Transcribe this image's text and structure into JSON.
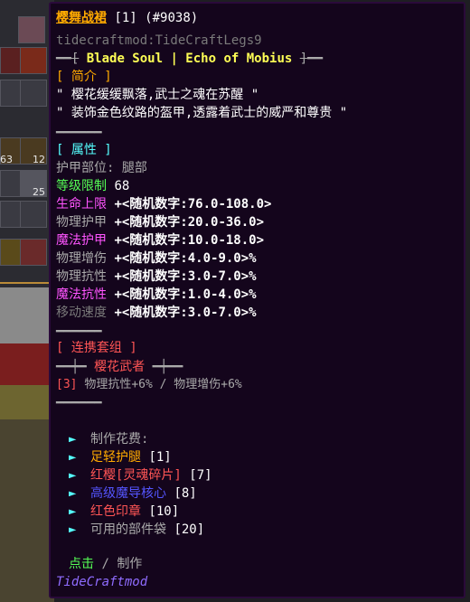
{
  "item": {
    "name": "樱舞战裙",
    "count": "[1]",
    "id": "(#9038)",
    "registry": "tidecraftmod:TideCraftLegs9",
    "series_prefix": "━━[",
    "series": "Blade Soul | Echo of Mobius",
    "series_suffix": "]━━",
    "intro_header": "[ 简介 ]",
    "intro_lines": [
      "\" 樱花缓缓飘落,武士之魂在苏醒 \"",
      "\" 装饰金色纹路的盔甲,透露着武士的威严和尊贵 \""
    ],
    "divider": "━━━━━━",
    "attr_header": "[ 属性 ]",
    "slot_label": "护甲部位:",
    "slot_value": "腿部",
    "level_label": "等级限制",
    "level_value": "68",
    "stats": [
      {
        "label": "生命上限",
        "value": "+<随机数字:76.0-108.0>",
        "color": "#ff55ff"
      },
      {
        "label": "物理护甲",
        "value": "+<随机数字:20.0-36.0>",
        "color": "#aaaaaa"
      },
      {
        "label": "魔法护甲",
        "value": "+<随机数字:10.0-18.0>",
        "color": "#ff55ff"
      },
      {
        "label": "物理增伤",
        "value": "+<随机数字:4.0-9.0>%",
        "color": "#aaaaaa"
      },
      {
        "label": "物理抗性",
        "value": "+<随机数字:3.0-7.0>%",
        "color": "#aaaaaa"
      },
      {
        "label": "魔法抗性",
        "value": "+<随机数字:1.0-4.0>%",
        "color": "#ff55ff"
      },
      {
        "label": "移动速度",
        "value": "+<随机数字:3.0-7.0>%",
        "color": "#7a7a7a"
      }
    ],
    "set_header": "[ 连携套组 ]",
    "set_name_prefix": "━━┿━",
    "set_name": "樱花武者",
    "set_name_suffix": "━┿━━",
    "set_bonus_count": "[3]",
    "set_bonus": "物理抗性+6% / 物理增伤+6%",
    "craft_header": "制作花费:",
    "materials": [
      {
        "name": "足轻护腿",
        "qty": "[1]",
        "color": "#ffaa00"
      },
      {
        "name": "红樱[灵魂碎片]",
        "qty": "[7]",
        "color": "#ff5555"
      },
      {
        "name": "高级魔导核心",
        "qty": "[8]",
        "color": "#5555ff"
      },
      {
        "name": "红色印章",
        "qty": "[10]",
        "color": "#ff5555"
      },
      {
        "name": "可用的部件袋",
        "qty": "[20]",
        "color": "#aaaaaa"
      }
    ],
    "action_click": "点击",
    "action_sep": "/",
    "action_craft": "制作",
    "mod_name": "TideCraftmod"
  },
  "inventory": {
    "count_a": "63",
    "count_b": "12",
    "count_c": "25"
  },
  "colors": {
    "gold": "#ffaa00",
    "aqua": "#55ffff",
    "green": "#55ff55",
    "pink": "#ff55ff",
    "blue": "#5555ff",
    "tooltip_bg": "#14051c"
  }
}
